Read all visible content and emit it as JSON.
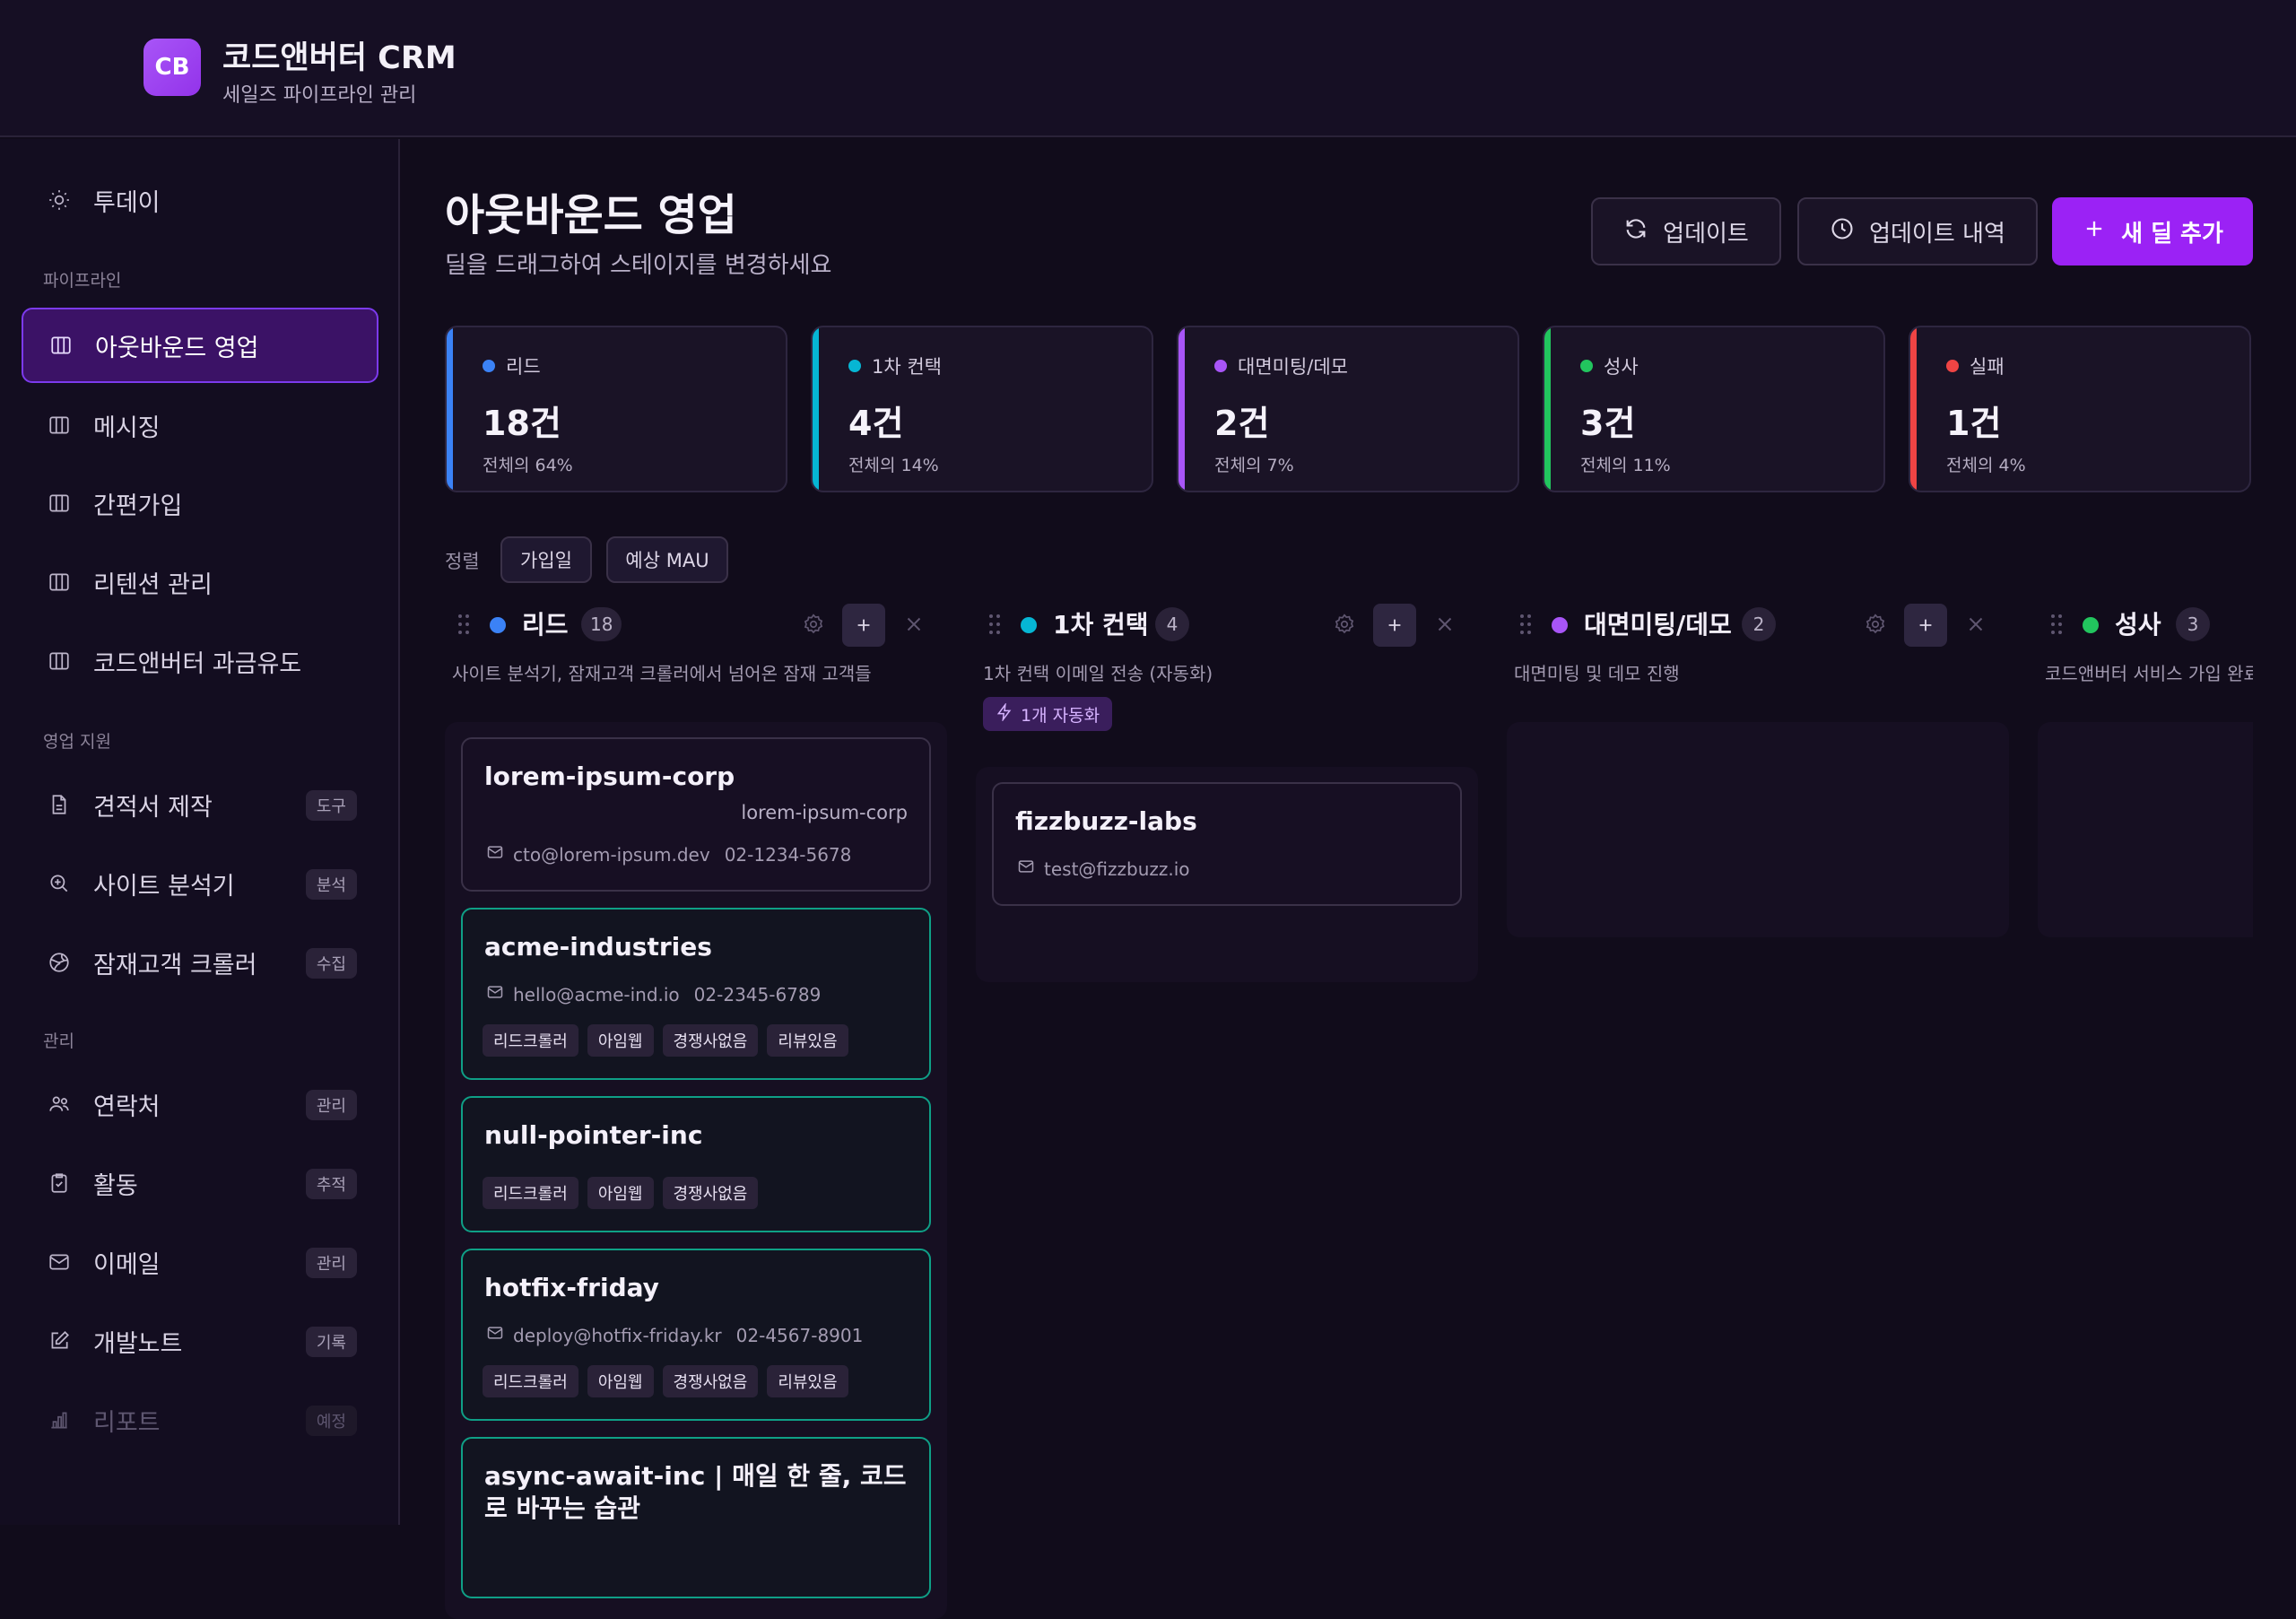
{
  "app": {
    "logo": "CB",
    "title": "코드앤버터 CRM",
    "subtitle": "세일즈 파이프라인 관리"
  },
  "sidebar": {
    "today": "투데이",
    "sections": {
      "pipeline": "파이프라인",
      "sales_support": "영업 지원",
      "management": "관리"
    },
    "pipelines": [
      "아웃바운드 영업",
      "메시징",
      "간편가입",
      "리텐션 관리",
      "코드앤버터 과금유도"
    ],
    "support": [
      {
        "label": "견적서 제작",
        "badge": "도구"
      },
      {
        "label": "사이트 분석기",
        "badge": "분석"
      },
      {
        "label": "잠재고객 크롤러",
        "badge": "수집"
      }
    ],
    "manage": [
      {
        "label": "연락처",
        "badge": "관리"
      },
      {
        "label": "활동",
        "badge": "추적"
      },
      {
        "label": "이메일",
        "badge": "관리"
      },
      {
        "label": "개발노트",
        "badge": "기록"
      },
      {
        "label": "리포트",
        "badge": "예정"
      }
    ]
  },
  "header": {
    "title": "아웃바운드 영업",
    "subtitle": "딜을 드래그하여 스테이지를 변경하세요",
    "update_label": "업데이트",
    "history_label": "업데이트 내역",
    "add_deal_label": "새 딜 추가"
  },
  "stats": [
    {
      "label": "리드",
      "value": "18건",
      "pct": "전체의 64%",
      "color": "#3b82f6"
    },
    {
      "label": "1차 컨택",
      "value": "4건",
      "pct": "전체의 14%",
      "color": "#06b6d4"
    },
    {
      "label": "대면미팅/데모",
      "value": "2건",
      "pct": "전체의 7%",
      "color": "#a855f7"
    },
    {
      "label": "성사",
      "value": "3건",
      "pct": "전체의 11%",
      "color": "#22c55e"
    },
    {
      "label": "실패",
      "value": "1건",
      "pct": "전체의 4%",
      "color": "#ef4444"
    }
  ],
  "sort": {
    "label": "정렬",
    "options": [
      "가입일",
      "예상 MAU"
    ]
  },
  "columns": [
    {
      "name": "리드",
      "count": "18",
      "desc": "사이트 분석기, 잠재고객 크롤러에서 넘어온 잠재 고객들",
      "color": "#3b82f6"
    },
    {
      "name": "1차 컨택",
      "count": "4",
      "desc": "1차 컨택 이메일 전송 (자동화)",
      "color": "#06b6d4",
      "automation": "1개 자동화"
    },
    {
      "name": "대면미팅/데모",
      "count": "2",
      "desc": "대면미팅 및 데모 진행",
      "color": "#a855f7"
    },
    {
      "name": "성사",
      "count": "3",
      "desc": "코드앤버터 서비스 가입 완료",
      "color": "#22c55e"
    }
  ],
  "cards": {
    "lead": [
      {
        "title": "lorem-ipsum-corp",
        "company": "lorem-ipsum-corp",
        "email": "cto@lorem-ipsum.dev",
        "phone": "02-1234-5678"
      },
      {
        "title": "acme-industries",
        "email": "hello@acme-ind.io",
        "phone": "02-2345-6789",
        "tags": [
          "리드크롤러",
          "아임웹",
          "경쟁사없음",
          "리뷰있음"
        ]
      },
      {
        "title": "null-pointer-inc",
        "tags": [
          "리드크롤러",
          "아임웹",
          "경쟁사없음"
        ]
      },
      {
        "title": "hotfix-friday",
        "email": "deploy@hotfix-friday.kr",
        "phone": "02-4567-8901",
        "tags": [
          "리드크롤러",
          "아임웹",
          "경쟁사없음",
          "리뷰있음"
        ]
      },
      {
        "title": "async-await-inc | 매일 한 줄, 코드로 바꾸는 습관"
      }
    ],
    "contact": [
      {
        "title": "fizzbuzz-labs",
        "email": "test@fizzbuzz.io"
      }
    ]
  }
}
